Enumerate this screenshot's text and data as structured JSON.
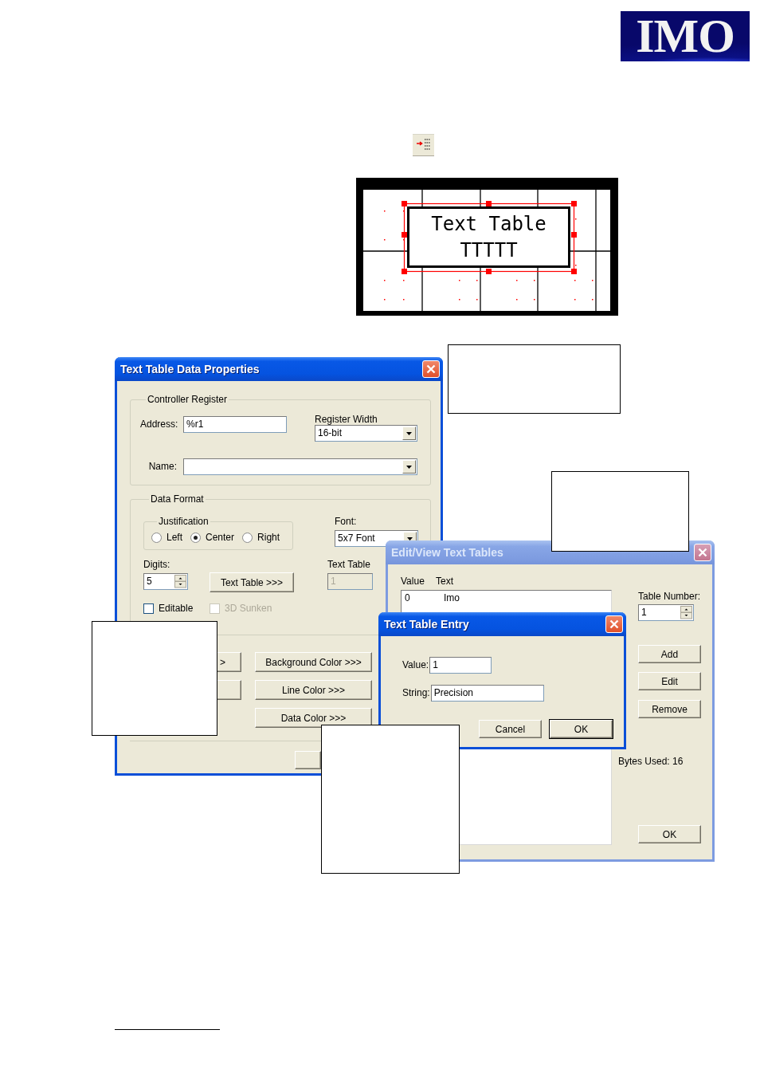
{
  "logo": {
    "text": "IMO"
  },
  "preview": {
    "lines": [
      "Text Table",
      "TTTTT"
    ]
  },
  "properties_dialog": {
    "title": "Text Table Data Properties",
    "active": true,
    "controller_register": {
      "legend": "Controller Register",
      "address_label": "Address:",
      "address": "%r1",
      "register_width_label": "Register Width",
      "register_width": "16-bit",
      "name_label": "Name:"
    },
    "data_format": {
      "legend": "Data Format",
      "justification": {
        "legend": "Justification",
        "options": [
          {
            "label": "Left",
            "selected": false
          },
          {
            "label": "Center",
            "selected": true
          },
          {
            "label": "Right",
            "selected": false
          }
        ]
      },
      "font_label": "Font:",
      "font": "5x7 Font",
      "digits_label": "Digits:",
      "digits": "5",
      "text_table_button": "Text Table >>>",
      "table_number_label": "Text Table",
      "table_number": "1",
      "table_number_disabled": true,
      "checkboxes": [
        {
          "label": "Editable",
          "checked": false,
          "disabled": false
        },
        {
          "label": "3D Sunken",
          "checked": false,
          "disabled": true
        }
      ]
    },
    "partial_button": ">",
    "color_buttons": [
      "Background Color >>>",
      "Line Color >>>",
      "Data Color >>>"
    ]
  },
  "tables_dialog": {
    "title": "Edit/View Text Tables",
    "active": false,
    "columns": [
      "Value",
      "Text"
    ],
    "rows": [
      {
        "value": "0",
        "text": "Imo"
      }
    ],
    "table_number_label": "Table Number:",
    "table_number": "1",
    "buttons": [
      "Add",
      "Edit",
      "Remove"
    ],
    "bytes_used": "Bytes Used: 16",
    "ok_button": "OK"
  },
  "entry_dialog": {
    "title": "Text Table Entry",
    "active": true,
    "value_label": "Value:",
    "value": "1",
    "string_label": "String:",
    "string": "Precision",
    "buttons": [
      {
        "label": "Cancel",
        "default": false
      },
      {
        "label": "OK",
        "default": true
      }
    ]
  }
}
